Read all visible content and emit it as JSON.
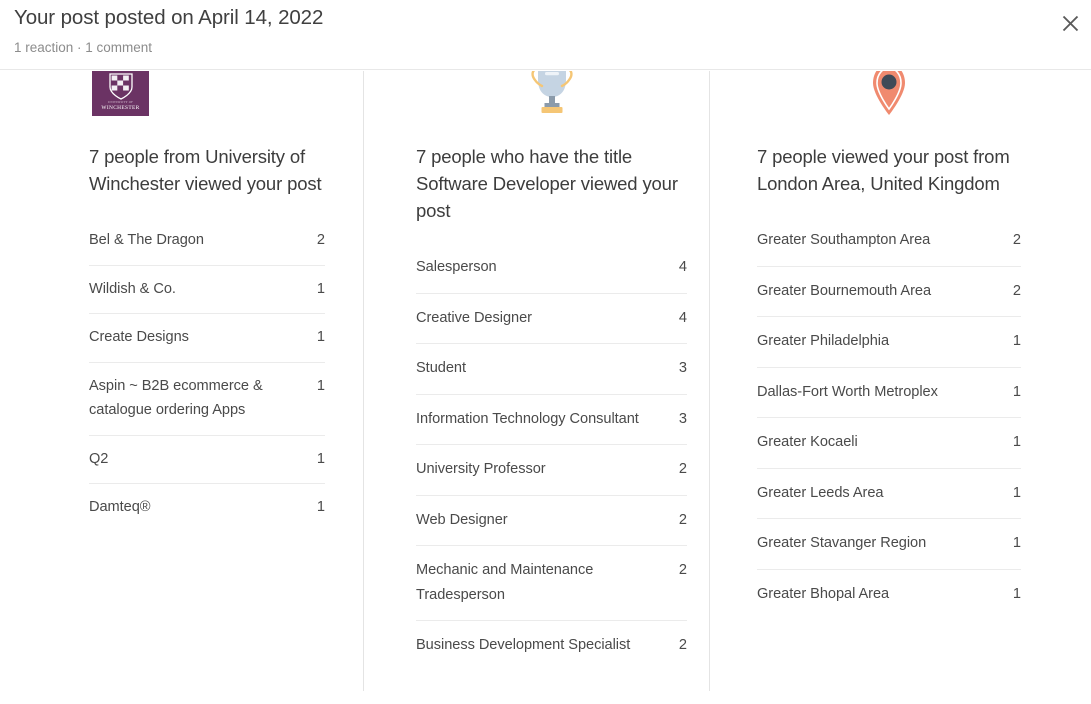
{
  "header": {
    "title": "Your post posted on April 14, 2022",
    "subtitle": "1 reaction · 1 comment",
    "close_label": "close-icon"
  },
  "colors": {
    "winchester_purple": "#6b3364",
    "trophy_cup": "#c5d4e3",
    "trophy_gold": "#f5c675",
    "trophy_stem": "#8b9bab",
    "pin_coral": "#f08a6f",
    "pin_dot": "#3f4a57",
    "divider": "#e4e4e4",
    "text_primary": "#3d3d3d",
    "text_secondary": "#8c8c8c"
  },
  "columns": [
    {
      "icon": "winchester-logo-icon",
      "logo_text_top": "UNIVERSITY OF",
      "logo_text_main": "WINCHESTER",
      "heading": "7 people from University of Winchester viewed your post",
      "rows": [
        {
          "label": "Bel & The Dragon",
          "value": "2"
        },
        {
          "label": "Wildish & Co.",
          "value": "1"
        },
        {
          "label": "Create Designs",
          "value": "1"
        },
        {
          "label": "Aspin ~ B2B ecommerce & catalogue ordering Apps",
          "value": "1"
        },
        {
          "label": "Q2",
          "value": "1"
        },
        {
          "label": "Damteq®",
          "value": "1"
        }
      ]
    },
    {
      "icon": "trophy-icon",
      "heading": "7 people who have the title Software Developer viewed your post",
      "rows": [
        {
          "label": "Salesperson",
          "value": "4"
        },
        {
          "label": "Creative Designer",
          "value": "4"
        },
        {
          "label": "Student",
          "value": "3"
        },
        {
          "label": "Information Technology Consultant",
          "value": "3"
        },
        {
          "label": "University Professor",
          "value": "2"
        },
        {
          "label": "Web Designer",
          "value": "2"
        },
        {
          "label": "Mechanic and Maintenance Tradesperson",
          "value": "2"
        },
        {
          "label": "Business Development Specialist",
          "value": "2"
        }
      ]
    },
    {
      "icon": "location-pin-icon",
      "heading": "7 people viewed your post from London Area, United Kingdom",
      "rows": [
        {
          "label": "Greater Southampton Area",
          "value": "2"
        },
        {
          "label": "Greater Bournemouth Area",
          "value": "2"
        },
        {
          "label": "Greater Philadelphia",
          "value": "1"
        },
        {
          "label": "Dallas-Fort Worth Metroplex",
          "value": "1"
        },
        {
          "label": "Greater Kocaeli",
          "value": "1"
        },
        {
          "label": "Greater Leeds Area",
          "value": "1"
        },
        {
          "label": "Greater Stavanger Region",
          "value": "1"
        },
        {
          "label": "Greater Bhopal Area",
          "value": "1"
        }
      ]
    }
  ]
}
